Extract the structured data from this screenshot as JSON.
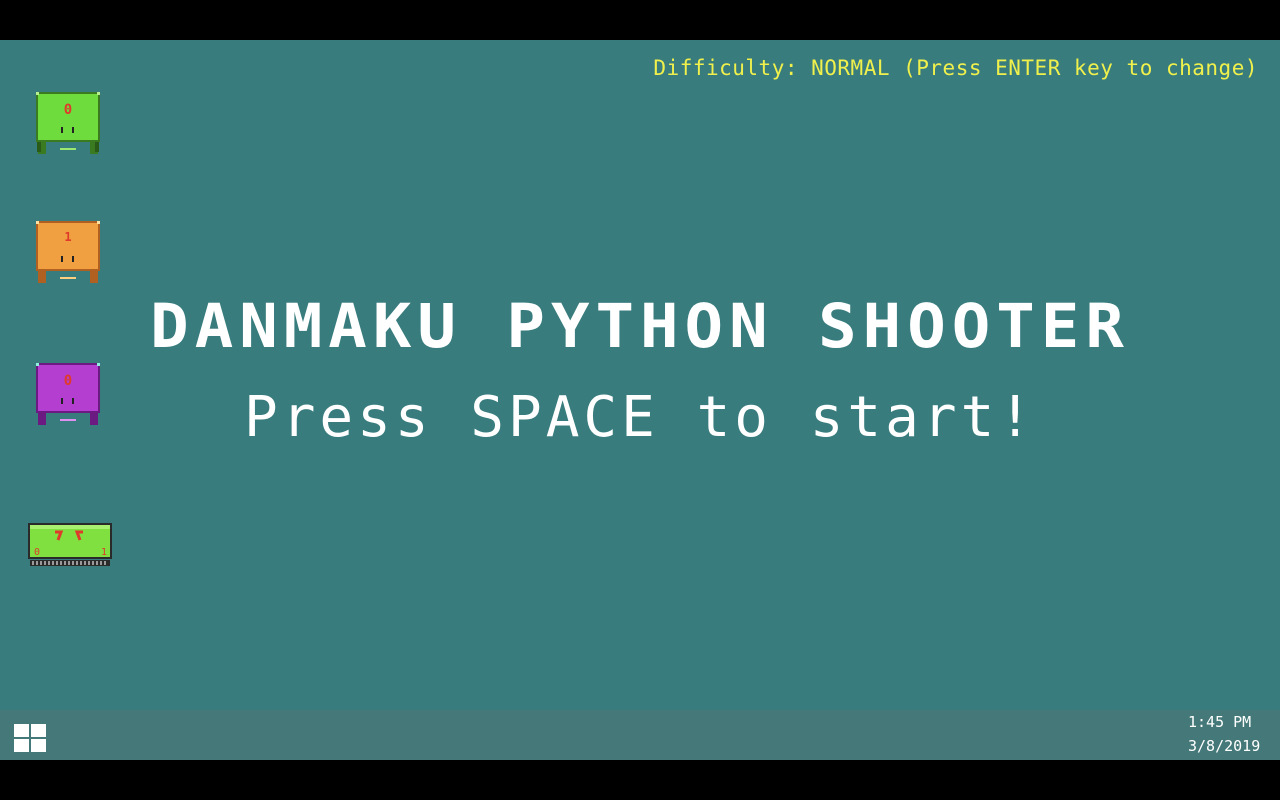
{
  "game": {
    "difficulty_text": "Difficulty: NORMAL (Press ENTER key to change)",
    "title": "DANMAKU PYTHON SHOOTER",
    "start_prompt": "Press SPACE to start!",
    "enemies": [
      {
        "name": "green-enemy",
        "label": "0",
        "color": "#6fdc3e"
      },
      {
        "name": "orange-enemy",
        "label": "1",
        "color": "#f0a040"
      },
      {
        "name": "purple-enemy",
        "label": "0",
        "color": "#b33ed0"
      },
      {
        "name": "player-ship",
        "labels": [
          "0",
          "1"
        ],
        "color": "#7fe040"
      }
    ]
  },
  "taskbar": {
    "start_icon": "windows-icon",
    "time": "1:45 PM",
    "date": "3/8/2019"
  },
  "colors": {
    "background": "#387c7e",
    "taskbar": "#457878",
    "difficulty_text": "#f0f04c",
    "title_text": "#ffffff"
  }
}
